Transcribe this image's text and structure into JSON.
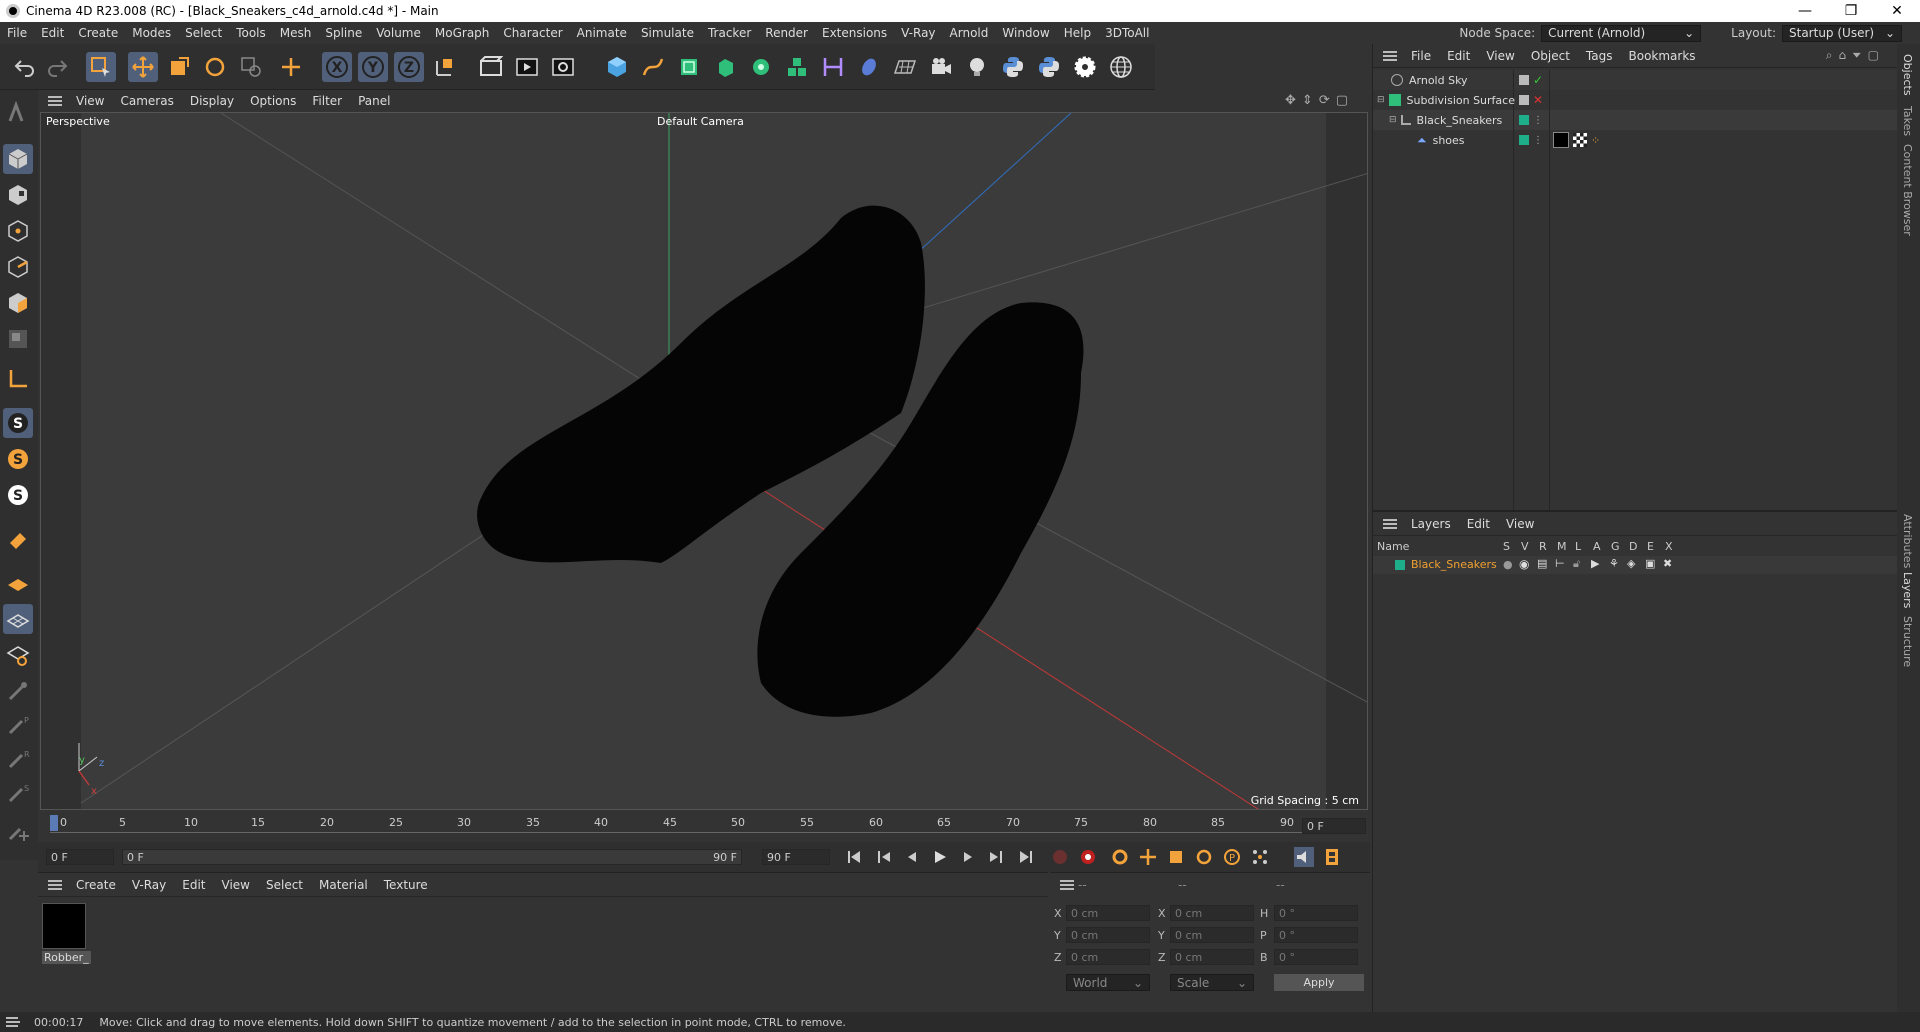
{
  "window": {
    "title": "Cinema 4D R23.008 (RC) - [Black_Sneakers_c4d_arnold.c4d *] - Main",
    "minimize": "—",
    "maximize": "❐",
    "close": "✕"
  },
  "menu": {
    "items": [
      "File",
      "Edit",
      "Create",
      "Modes",
      "Select",
      "Tools",
      "Mesh",
      "Spline",
      "Volume",
      "MoGraph",
      "Character",
      "Animate",
      "Simulate",
      "Tracker",
      "Render",
      "Extensions",
      "V-Ray",
      "Arnold",
      "Window",
      "Help",
      "3DToAll"
    ],
    "node_space_label": "Node Space:",
    "node_space_value": "Current (Arnold)",
    "layout_label": "Layout:",
    "layout_value": "Startup (User)"
  },
  "viewport": {
    "menu": [
      "View",
      "Cameras",
      "Display",
      "Options",
      "Filter",
      "Panel"
    ],
    "view_name": "Perspective",
    "camera": "Default Camera",
    "grid_spacing": "Grid Spacing : 5 cm",
    "axis_y": "y",
    "axis_z": "z",
    "axis_x": "x"
  },
  "timeline": {
    "ticks": [
      "0",
      "5",
      "10",
      "15",
      "20",
      "25",
      "30",
      "35",
      "40",
      "45",
      "50",
      "55",
      "60",
      "65",
      "70",
      "75",
      "80",
      "85",
      "90"
    ],
    "current_frame": "0 F",
    "start_frame": "0 F",
    "range_start": "0 F",
    "range_end": "90 F",
    "end_frame": "90 F"
  },
  "material_panel": {
    "menu": [
      "Create",
      "V-Ray",
      "Edit",
      "View",
      "Select",
      "Material",
      "Texture"
    ],
    "materials": [
      {
        "name": "Robber_"
      }
    ]
  },
  "coord_panel": {
    "headers": [
      "--",
      "--",
      "--"
    ],
    "rows": [
      {
        "a": "X",
        "av": "0 cm",
        "b": "X",
        "bv": "0 cm",
        "c": "H",
        "cv": "0 °"
      },
      {
        "a": "Y",
        "av": "0 cm",
        "b": "Y",
        "bv": "0 cm",
        "c": "P",
        "cv": "0 °"
      },
      {
        "a": "Z",
        "av": "0 cm",
        "b": "Z",
        "bv": "0 cm",
        "c": "B",
        "cv": "0 °"
      }
    ],
    "coord_system": "World",
    "mode": "Scale",
    "apply": "Apply"
  },
  "object_manager": {
    "menu": [
      "File",
      "Edit",
      "View",
      "Object",
      "Tags",
      "Bookmarks"
    ],
    "objects": [
      {
        "name": "Arnold Sky"
      },
      {
        "name": "Subdivision Surface"
      },
      {
        "name": "Black_Sneakers"
      },
      {
        "name": "shoes"
      }
    ]
  },
  "layer_manager": {
    "menu": [
      "Layers",
      "Edit",
      "View"
    ],
    "name_col": "Name",
    "flags": [
      "S",
      "V",
      "R",
      "M",
      "L",
      "A",
      "G",
      "D",
      "E",
      "X"
    ],
    "layers": [
      {
        "name": "Black_Sneakers",
        "color": "#1fae8a"
      }
    ]
  },
  "side_tabs": [
    "Objects",
    "Takes",
    "Content Browser",
    "Attributes",
    "Layers",
    "Structure"
  ],
  "status": {
    "time": "00:00:17",
    "message": "Move: Click and drag to move elements. Hold down SHIFT to quantize movement / add to the selection in point mode, CTRL to remove."
  },
  "colors": {
    "accent": "#51607a",
    "layer_text": "#f0a030",
    "tag_green": "#1fae8a"
  }
}
